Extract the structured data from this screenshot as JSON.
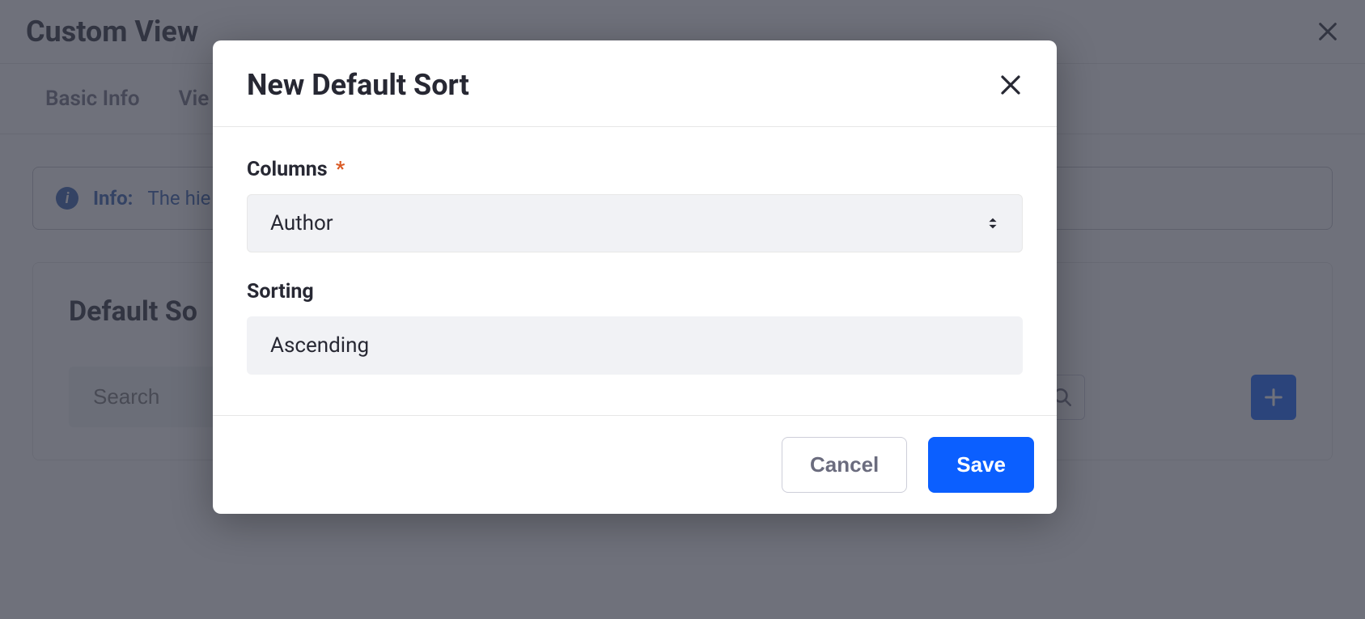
{
  "background": {
    "title": "Custom View",
    "tabs": [
      "Basic Info",
      "Vie"
    ],
    "info": {
      "label": "Info:",
      "text": "The hie"
    },
    "section_title": "Default So",
    "search_placeholder": "Search"
  },
  "modal": {
    "title": "New Default Sort",
    "columns": {
      "label": "Columns",
      "required": "*",
      "value": "Author"
    },
    "sorting": {
      "label": "Sorting",
      "value": "Ascending"
    },
    "cancel_label": "Cancel",
    "save_label": "Save"
  },
  "colors": {
    "primary": "#0b5fff",
    "accent_required": "#da5a24",
    "info": "#2e5aac"
  }
}
